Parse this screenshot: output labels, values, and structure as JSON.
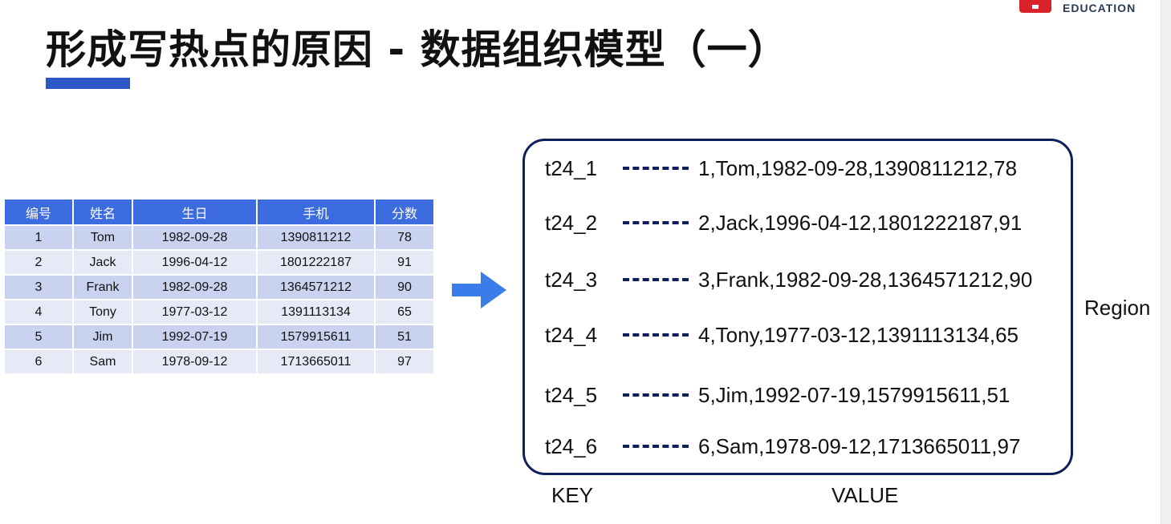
{
  "logo": {
    "text": "EDUCATION",
    "brand_color": "#d8232a"
  },
  "title": "形成写热点的原因 - 数据组织模型（一）",
  "accent_color": "#2b57c9",
  "table": {
    "header_color": "#3d6be0",
    "columns": [
      "编号",
      "姓名",
      "生日",
      "手机",
      "分数"
    ],
    "rows": [
      [
        "1",
        "Tom",
        "1982-09-28",
        "1390811212",
        "78"
      ],
      [
        "2",
        "Jack",
        "1996-04-12",
        "1801222187",
        "91"
      ],
      [
        "3",
        "Frank",
        "1982-09-28",
        "1364571212",
        "90"
      ],
      [
        "4",
        "Tony",
        "1977-03-12",
        "1391113134",
        "65"
      ],
      [
        "5",
        "Jim",
        "1992-07-19",
        "1579915611",
        "51"
      ],
      [
        "6",
        "Sam",
        "1978-09-12",
        "1713665011",
        "97"
      ]
    ]
  },
  "arrow_color": "#3a7de8",
  "region": {
    "label": "Region",
    "border_color": "#0f1f5c",
    "entries": [
      {
        "key": "t24_1",
        "value": "1,Tom,1982-09-28,1390811212,78"
      },
      {
        "key": "t24_2",
        "value": "2,Jack,1996-04-12,1801222187,91"
      },
      {
        "key": "t24_3",
        "value": "3,Frank,1982-09-28,1364571212,90"
      },
      {
        "key": "t24_4",
        "value": "4,Tony,1977-03-12,1391113134,65"
      },
      {
        "key": "t24_5",
        "value": "5,Jim,1992-07-19,1579915611,51"
      },
      {
        "key": "t24_6",
        "value": "6,Sam,1978-09-12,1713665011,97"
      }
    ]
  },
  "footer": {
    "key_label": "KEY",
    "value_label": "VALUE"
  }
}
